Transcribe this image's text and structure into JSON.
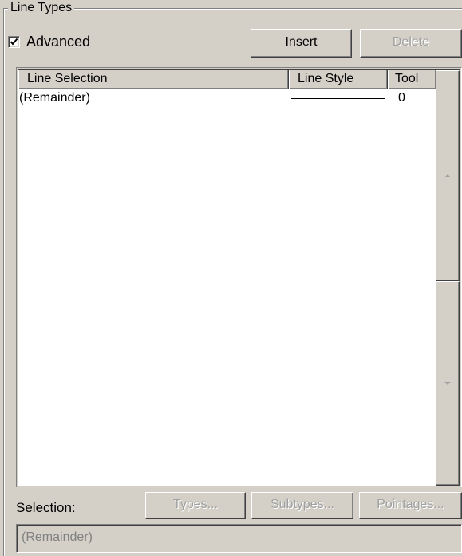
{
  "group": {
    "title": "Line Types"
  },
  "advanced": {
    "label": "Advanced",
    "checked": true
  },
  "buttons": {
    "insert": "Insert",
    "delete": "Delete",
    "types": "Types...",
    "subtypes": "Subtypes...",
    "pointages": "Pointages..."
  },
  "list": {
    "columns": [
      "Line Selection",
      "Line Style",
      "Tool"
    ],
    "rows": [
      {
        "selection": "(Remainder)",
        "style": "solid-line",
        "tool": "0"
      }
    ]
  },
  "selection": {
    "label": "Selection:",
    "value": "(Remainder)"
  },
  "icons": {
    "checkmark": "checkmark-icon",
    "scroll_up": "up-arrow-icon",
    "scroll_down": "down-arrow-icon"
  },
  "colors": {
    "face": "#d4d0c8",
    "disabled_text": "#a0a0a0",
    "list_bg": "#ffffff"
  }
}
